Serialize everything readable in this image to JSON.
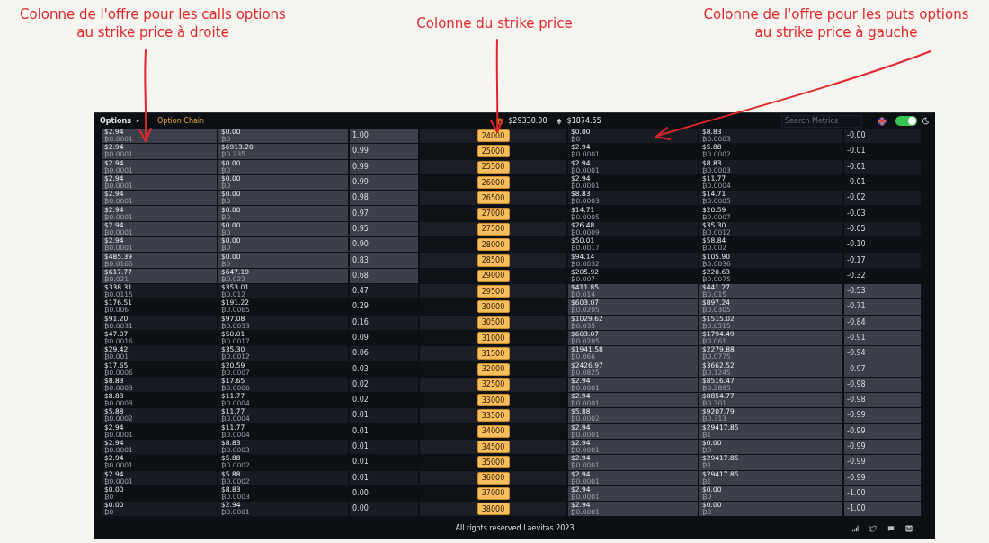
{
  "annotations": [
    {
      "lines": [
        "Colonne de l'offre pour les calls options",
        "au strike price à droite"
      ]
    },
    {
      "lines": [
        "Colonne du strike price"
      ]
    },
    {
      "lines": [
        "Colonne de l'offre pour les puts options",
        "au strike price à gauche"
      ]
    }
  ],
  "header": {
    "title": "Options",
    "breadcrumb": "Option Chain",
    "btc_price": "$29330.00",
    "eth_price": "$1874.55",
    "search": {
      "placeholder": "Search Metrics"
    },
    "theme_toggle": {
      "on": true
    }
  },
  "rows": [
    {
      "strike": "24000",
      "column_1": [
        "$2.94",
        "₿0.0001"
      ],
      "column_2": [
        "$0.00",
        "₿0"
      ],
      "column_3": "1.00",
      "column_5": [
        "$0.00",
        "₿0"
      ],
      "column_6": [
        "$8.83",
        "₿0.0003"
      ],
      "column_7": "-0.00",
      "left_highlighted": true,
      "right_highlighted": false
    },
    {
      "strike": "25000",
      "column_1": [
        "$2.94",
        "₿0.0001"
      ],
      "column_2": [
        "$6913.20",
        "₿0.235"
      ],
      "column_3": "0.99",
      "column_5": [
        "$2.94",
        "₿0.0001"
      ],
      "column_6": [
        "$5.88",
        "₿0.0002"
      ],
      "column_7": "-0.01",
      "left_highlighted": true,
      "right_highlighted": false
    },
    {
      "strike": "25500",
      "column_1": [
        "$2.94",
        "₿0.0001"
      ],
      "column_2": [
        "$0.00",
        "₿0"
      ],
      "column_3": "0.99",
      "column_5": [
        "$2.94",
        "₿0.0001"
      ],
      "column_6": [
        "$8.83",
        "₿0.0003"
      ],
      "column_7": "-0.01",
      "left_highlighted": true,
      "right_highlighted": false
    },
    {
      "strike": "26000",
      "column_1": [
        "$2.94",
        "₿0.0001"
      ],
      "column_2": [
        "$0.00",
        "₿0"
      ],
      "column_3": "0.99",
      "column_5": [
        "$2.94",
        "₿0.0001"
      ],
      "column_6": [
        "$11.77",
        "₿0.0004"
      ],
      "column_7": "-0.01",
      "left_highlighted": true,
      "right_highlighted": false
    },
    {
      "strike": "26500",
      "column_1": [
        "$2.94",
        "₿0.0001"
      ],
      "column_2": [
        "$0.00",
        "₿0"
      ],
      "column_3": "0.98",
      "column_5": [
        "$8.83",
        "₿0.0003"
      ],
      "column_6": [
        "$14.71",
        "₿0.0005"
      ],
      "column_7": "-0.02",
      "left_highlighted": true,
      "right_highlighted": false
    },
    {
      "strike": "27000",
      "column_1": [
        "$2.94",
        "₿0.0001"
      ],
      "column_2": [
        "$0.00",
        "₿0"
      ],
      "column_3": "0.97",
      "column_5": [
        "$14.71",
        "₿0.0005"
      ],
      "column_6": [
        "$20.59",
        "₿0.0007"
      ],
      "column_7": "-0.03",
      "left_highlighted": true,
      "right_highlighted": false
    },
    {
      "strike": "27500",
      "column_1": [
        "$2.94",
        "₿0.0001"
      ],
      "column_2": [
        "$0.00",
        "₿0"
      ],
      "column_3": "0.95",
      "column_5": [
        "$26.48",
        "₿0.0009"
      ],
      "column_6": [
        "$35.30",
        "₿0.0012"
      ],
      "column_7": "-0.05",
      "left_highlighted": true,
      "right_highlighted": false
    },
    {
      "strike": "28000",
      "column_1": [
        "$2.94",
        "₿0.0001"
      ],
      "column_2": [
        "$0.00",
        "₿0"
      ],
      "column_3": "0.90",
      "column_5": [
        "$50.01",
        "₿0.0017"
      ],
      "column_6": [
        "$58.84",
        "₿0.002"
      ],
      "column_7": "-0.10",
      "left_highlighted": true,
      "right_highlighted": false
    },
    {
      "strike": "28500",
      "column_1": [
        "$485.39",
        "₿0.0165"
      ],
      "column_2": [
        "$0.00",
        "₿0"
      ],
      "column_3": "0.83",
      "column_5": [
        "$94.14",
        "₿0.0032"
      ],
      "column_6": [
        "$105.90",
        "₿0.0036"
      ],
      "column_7": "-0.17",
      "left_highlighted": true,
      "right_highlighted": false
    },
    {
      "strike": "29000",
      "column_1": [
        "$617.77",
        "₿0.021"
      ],
      "column_2": [
        "$647.19",
        "₿0.022"
      ],
      "column_3": "0.68",
      "column_5": [
        "$205.92",
        "₿0.007"
      ],
      "column_6": [
        "$220.63",
        "₿0.0075"
      ],
      "column_7": "-0.32",
      "left_highlighted": true,
      "right_highlighted": false
    },
    {
      "strike": "29500",
      "column_1": [
        "$338.31",
        "₿0.0115"
      ],
      "column_2": [
        "$353.01",
        "₿0.012"
      ],
      "column_3": "0.47",
      "column_5": [
        "$411.85",
        "₿0.014"
      ],
      "column_6": [
        "$441.27",
        "₿0.015"
      ],
      "column_7": "-0.53",
      "left_highlighted": false,
      "right_highlighted": true
    },
    {
      "strike": "30000",
      "column_1": [
        "$176.51",
        "₿0.006"
      ],
      "column_2": [
        "$191.22",
        "₿0.0065"
      ],
      "column_3": "0.29",
      "column_5": [
        "$603.07",
        "₿0.0205"
      ],
      "column_6": [
        "$897.24",
        "₿0.0305"
      ],
      "column_7": "-0.71",
      "left_highlighted": false,
      "right_highlighted": true
    },
    {
      "strike": "30500",
      "column_1": [
        "$91.20",
        "₿0.0031"
      ],
      "column_2": [
        "$97.08",
        "₿0.0033"
      ],
      "column_3": "0.16",
      "column_5": [
        "$1029.62",
        "₿0.035"
      ],
      "column_6": [
        "$1515.02",
        "₿0.0515"
      ],
      "column_7": "-0.84",
      "left_highlighted": false,
      "right_highlighted": true
    },
    {
      "strike": "31000",
      "column_1": [
        "$47.07",
        "₿0.0016"
      ],
      "column_2": [
        "$50.01",
        "₿0.0017"
      ],
      "column_3": "0.09",
      "column_5": [
        "$603.07",
        "₿0.0205"
      ],
      "column_6": [
        "$1794.49",
        "₿0.061"
      ],
      "column_7": "-0.91",
      "left_highlighted": false,
      "right_highlighted": true
    },
    {
      "strike": "31500",
      "column_1": [
        "$29.42",
        "₿0.001"
      ],
      "column_2": [
        "$35.30",
        "₿0.0012"
      ],
      "column_3": "0.06",
      "column_5": [
        "$1941.58",
        "₿0.066"
      ],
      "column_6": [
        "$2279.88",
        "₿0.0775"
      ],
      "column_7": "-0.94",
      "left_highlighted": false,
      "right_highlighted": true
    },
    {
      "strike": "32000",
      "column_1": [
        "$17.65",
        "₿0.0006"
      ],
      "column_2": [
        "$20.59",
        "₿0.0007"
      ],
      "column_3": "0.03",
      "column_5": [
        "$2426.97",
        "₿0.0825"
      ],
      "column_6": [
        "$3662.52",
        "₿0.1245"
      ],
      "column_7": "-0.97",
      "left_highlighted": false,
      "right_highlighted": true
    },
    {
      "strike": "32500",
      "column_1": [
        "$8.83",
        "₿0.0003"
      ],
      "column_2": [
        "$17.65",
        "₿0.0006"
      ],
      "column_3": "0.02",
      "column_5": [
        "$2.94",
        "₿0.0001"
      ],
      "column_6": [
        "$8516.47",
        "₿0.2895"
      ],
      "column_7": "-0.98",
      "left_highlighted": false,
      "right_highlighted": true
    },
    {
      "strike": "33000",
      "column_1": [
        "$8.83",
        "₿0.0003"
      ],
      "column_2": [
        "$11.77",
        "₿0.0004"
      ],
      "column_3": "0.02",
      "column_5": [
        "$2.94",
        "₿0.0001"
      ],
      "column_6": [
        "$8854.77",
        "₿0.301"
      ],
      "column_7": "-0.98",
      "left_highlighted": false,
      "right_highlighted": true
    },
    {
      "strike": "33500",
      "column_1": [
        "$5.88",
        "₿0.0002"
      ],
      "column_2": [
        "$11.77",
        "₿0.0004"
      ],
      "column_3": "0.01",
      "column_5": [
        "$5.88",
        "₿0.0002"
      ],
      "column_6": [
        "$9207.79",
        "₿0.313"
      ],
      "column_7": "-0.99",
      "left_highlighted": false,
      "right_highlighted": true
    },
    {
      "strike": "34000",
      "column_1": [
        "$2.94",
        "₿0.0001"
      ],
      "column_2": [
        "$11.77",
        "₿0.0004"
      ],
      "column_3": "0.01",
      "column_5": [
        "$2.94",
        "₿0.0001"
      ],
      "column_6": [
        "$29417.85",
        "₿1"
      ],
      "column_7": "-0.99",
      "left_highlighted": false,
      "right_highlighted": true
    },
    {
      "strike": "34500",
      "column_1": [
        "$2.94",
        "₿0.0001"
      ],
      "column_2": [
        "$8.83",
        "₿0.0003"
      ],
      "column_3": "0.01",
      "column_5": [
        "$2.94",
        "₿0.0001"
      ],
      "column_6": [
        "$0.00",
        "₿0"
      ],
      "column_7": "-0.99",
      "left_highlighted": false,
      "right_highlighted": true
    },
    {
      "strike": "35000",
      "column_1": [
        "$2.94",
        "₿0.0001"
      ],
      "column_2": [
        "$5.88",
        "₿0.0002"
      ],
      "column_3": "0.01",
      "column_5": [
        "$2.94",
        "₿0.0001"
      ],
      "column_6": [
        "$29417.85",
        "₿1"
      ],
      "column_7": "-0.99",
      "left_highlighted": false,
      "right_highlighted": true
    },
    {
      "strike": "36000",
      "column_1": [
        "$2.94",
        "₿0.0001"
      ],
      "column_2": [
        "$5.88",
        "₿0.0002"
      ],
      "column_3": "0.01",
      "column_5": [
        "$2.94",
        "₿0.0001"
      ],
      "column_6": [
        "$29417.85",
        "₿1"
      ],
      "column_7": "-0.99",
      "left_highlighted": false,
      "right_highlighted": true
    },
    {
      "strike": "37000",
      "column_1": [
        "$0.00",
        "₿0"
      ],
      "column_2": [
        "$8.83",
        "₿0.0003"
      ],
      "column_3": "0.00",
      "column_5": [
        "$2.94",
        "₿0.0001"
      ],
      "column_6": [
        "$0.00",
        "₿0"
      ],
      "column_7": "-1.00",
      "left_highlighted": false,
      "right_highlighted": true
    },
    {
      "strike": "38000",
      "column_1": [
        "$0.00",
        "₿0"
      ],
      "column_2": [
        "$2.94",
        "₿0.0001"
      ],
      "column_3": "0.00",
      "column_5": [
        "$2.94",
        "₿0.0001"
      ],
      "column_6": [
        "$0.00",
        "₿0"
      ],
      "column_7": "-1.00",
      "left_highlighted": false,
      "right_highlighted": true
    }
  ],
  "footer": {
    "copyright": "All rights reserved Laevitas 2023"
  }
}
